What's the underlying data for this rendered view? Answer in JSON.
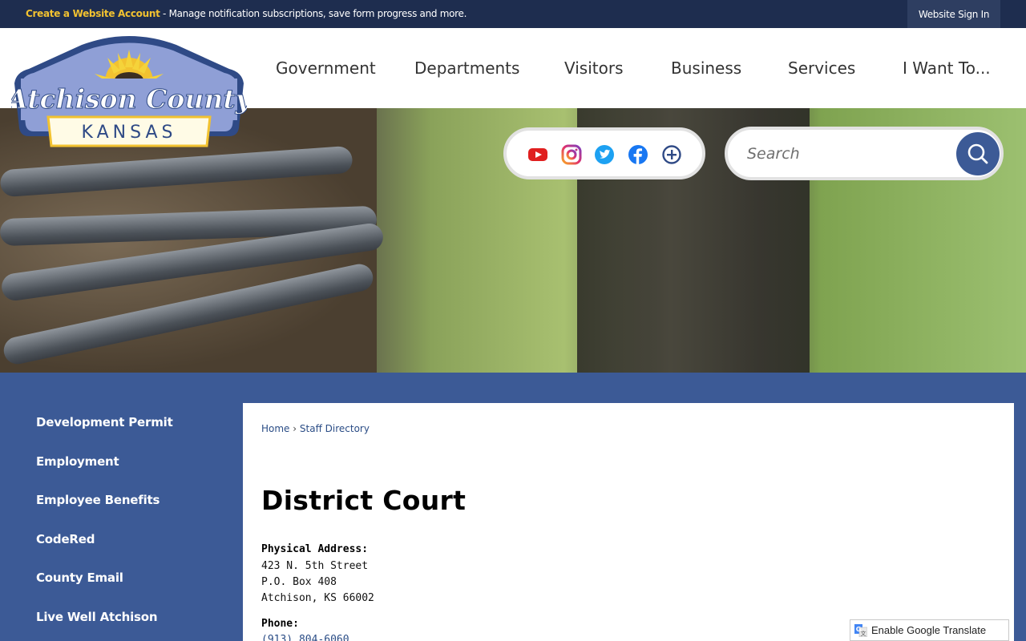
{
  "topbar": {
    "create_account": "Create a Website Account",
    "message": " - Manage notification subscriptions, save form progress and more.",
    "signin_label": "Website Sign In"
  },
  "logo": {
    "name": "Atchison County",
    "state": "KANSAS"
  },
  "nav": {
    "items": [
      "Government",
      "Departments",
      "Visitors",
      "Business",
      "Services",
      "I Want To..."
    ]
  },
  "social": {
    "icons": [
      "youtube-icon",
      "instagram-icon",
      "twitter-icon",
      "facebook-icon",
      "more-icon"
    ]
  },
  "search": {
    "placeholder": "Search"
  },
  "sidebar": {
    "items": [
      "Development Permit",
      "Employment",
      "Employee Benefits",
      "CodeRed",
      "County Email",
      "Live Well Atchison"
    ]
  },
  "breadcrumb": {
    "home": "Home",
    "separator": "›",
    "current": "Staff Directory"
  },
  "page": {
    "title": "District Court",
    "address_label": "Physical Address:",
    "address_lines": [
      "423 N. 5th Street",
      "P.O. Box 408",
      "Atchison, KS 66002"
    ],
    "phone_label": "Phone:",
    "phone": "(913) 804-6060"
  },
  "translate": {
    "label": "Enable Google Translate"
  },
  "colors": {
    "brand_blue": "#3c5a96",
    "topbar": "#1e2d4f",
    "accent_yellow": "#f2c230"
  }
}
